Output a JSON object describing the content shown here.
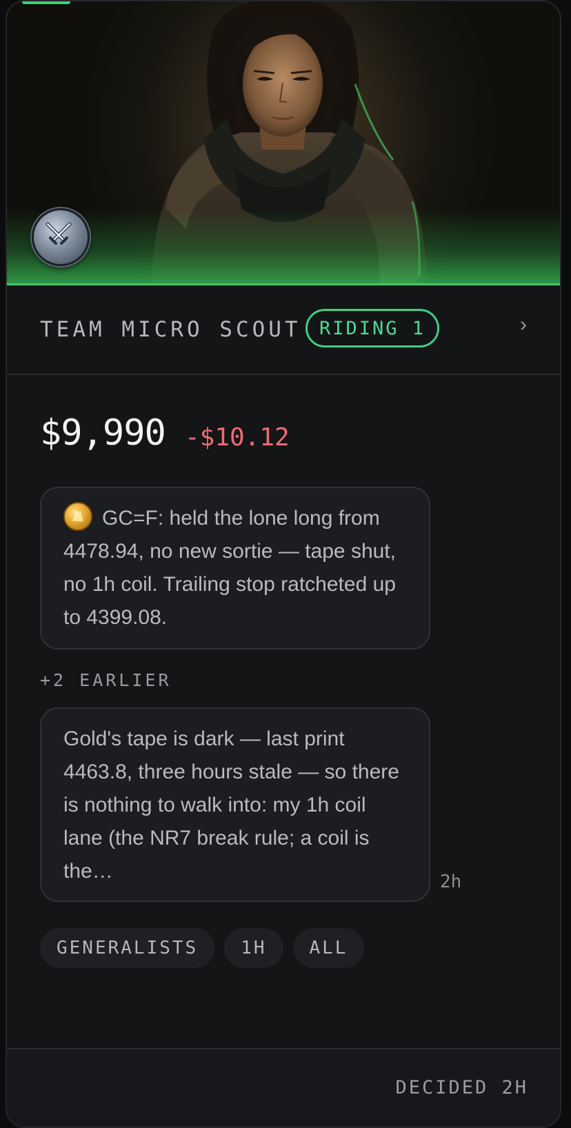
{
  "hero": {
    "image": "character-portrait",
    "badge_icon": "crossed-swords-icon",
    "accent_color": "#45c46a"
  },
  "header": {
    "team_name": "TEAM MICRO SCOUT",
    "status_pill": "RIDING 1",
    "chevron": "›"
  },
  "balance": {
    "value": "$9,990",
    "delta": "-$10.12",
    "delta_color": "#ef6b73"
  },
  "latest_message": {
    "icon": "gold-coin-icon",
    "text": "GC=F: held the lone long from 4478.94, no new sortie — tape shut, no 1h coil. Trailing stop ratcheted up to 4399.08."
  },
  "earlier": {
    "label": "+2 EARLIER"
  },
  "earlier_message": {
    "text": "Gold's tape is dark — last print 4463.8, three hours stale — so there is nothing to walk into: my 1h coil lane (the NR7 break rule; a coil is the…",
    "time": "2h"
  },
  "tags": [
    "GENERALISTS",
    "1H",
    "ALL"
  ],
  "footer": {
    "status": "DECIDED 2H"
  }
}
